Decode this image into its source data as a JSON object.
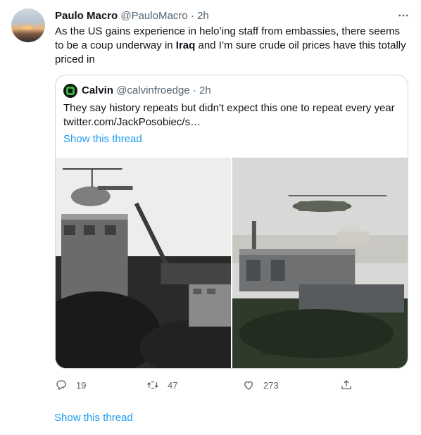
{
  "tweet": {
    "display_name": "Paulo Macro",
    "handle": "@PauloMacro",
    "separator": "·",
    "time": "2h",
    "text_part1": "As the US gains experience in helo’ing staff from embassies, there seems to be a coup underway in ",
    "text_bold": "Iraq",
    "text_part2": " and I’m sure crude oil prices have this totally priced in"
  },
  "quoted": {
    "display_name": "Calvin",
    "handle": "@calvinfroedge",
    "separator": "·",
    "time": "2h",
    "text": "They say history repeats but didn't expect this one to repeat every year",
    "link": "twitter.com/JackPosobiec/s…",
    "show_thread": "Show this thread"
  },
  "actions": {
    "reply_count": "19",
    "retweet_count": "47",
    "like_count": "273"
  },
  "show_thread": "Show this thread",
  "icons": {
    "more": "more-horizontal-icon",
    "reply": "reply-icon",
    "retweet": "retweet-icon",
    "like": "heart-icon",
    "share": "share-icon"
  },
  "colors": {
    "link": "#1d9bf0",
    "muted": "#536471",
    "text": "#0f1419",
    "border": "#cfd9de"
  }
}
